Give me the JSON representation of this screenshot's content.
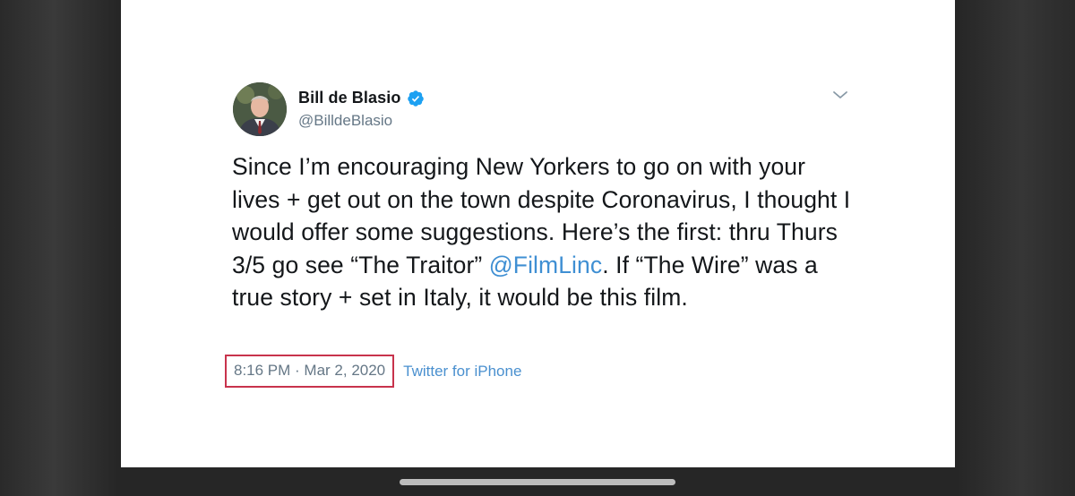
{
  "tweet": {
    "author": {
      "display_name": "Bill de Blasio",
      "handle": "@BilldeBlasio",
      "verified": true
    },
    "text_parts": {
      "before_mention": "Since I’m encouraging New Yorkers to go on with your lives + get out on the town despite Coronavirus, I thought I would offer some suggestions. Here’s the first: thru Thurs 3/5 go see “The Traitor” ",
      "mention": "@FilmLinc",
      "after_mention": ". If “The Wire” was a true story + set in Italy, it would be this film."
    },
    "timestamp": "8:16 PM · Mar 2, 2020",
    "source": "Twitter for iPhone"
  },
  "icons": {
    "verified": "verified-badge-icon",
    "menu": "chevron-down-icon"
  },
  "colors": {
    "verified_blue": "#1da1f2",
    "link_blue": "#3f8fd3",
    "highlight_border": "#c8334c",
    "muted_text": "#657786"
  }
}
